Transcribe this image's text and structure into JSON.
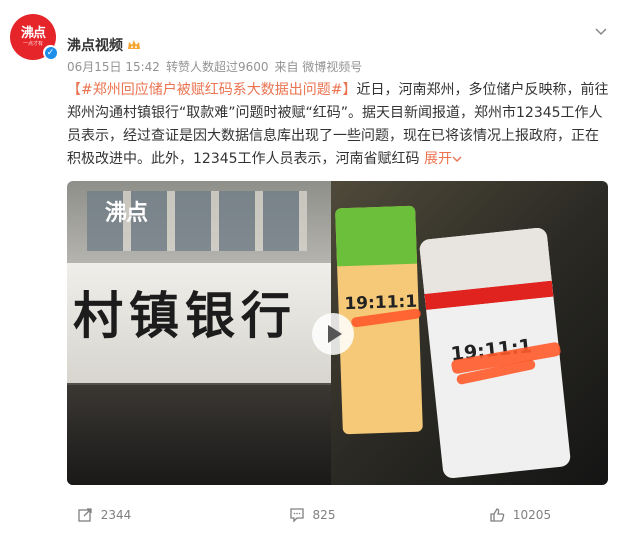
{
  "author": {
    "name": "沸点视频",
    "avatar_text": "沸点",
    "avatar_sub": "一点才有"
  },
  "post": {
    "date": "06月15日 15:42",
    "repost_info": "转赞人数超过9600",
    "source": "来自 微博视频号",
    "hashtag": "【#郑州回应储户被赋红码系大数据出问题#】",
    "body": "近日，河南郑州，多位储户反映称，前往郑州沟通村镇银行“取款难”问题时被赋“红码”。据天目新闻报道，郑州市12345工作人员表示，经过查证是因大数据信息库出现了一些问题，现在已将该情况上报政府，正在积极改进中。此外，12345工作人员表示，河南省赋红码",
    "expand_label": "展开"
  },
  "media": {
    "watermark": "沸点",
    "sign_text": "村镇银行",
    "phone1_time": "19:11:1",
    "phone2_time": "19:11:1"
  },
  "actions": {
    "repost_count": "2344",
    "comment_count": "825",
    "like_count": "10205"
  },
  "colors": {
    "accent": "#eb7350",
    "brand_red": "#e5252a",
    "verified_blue": "#1e8eeb"
  }
}
